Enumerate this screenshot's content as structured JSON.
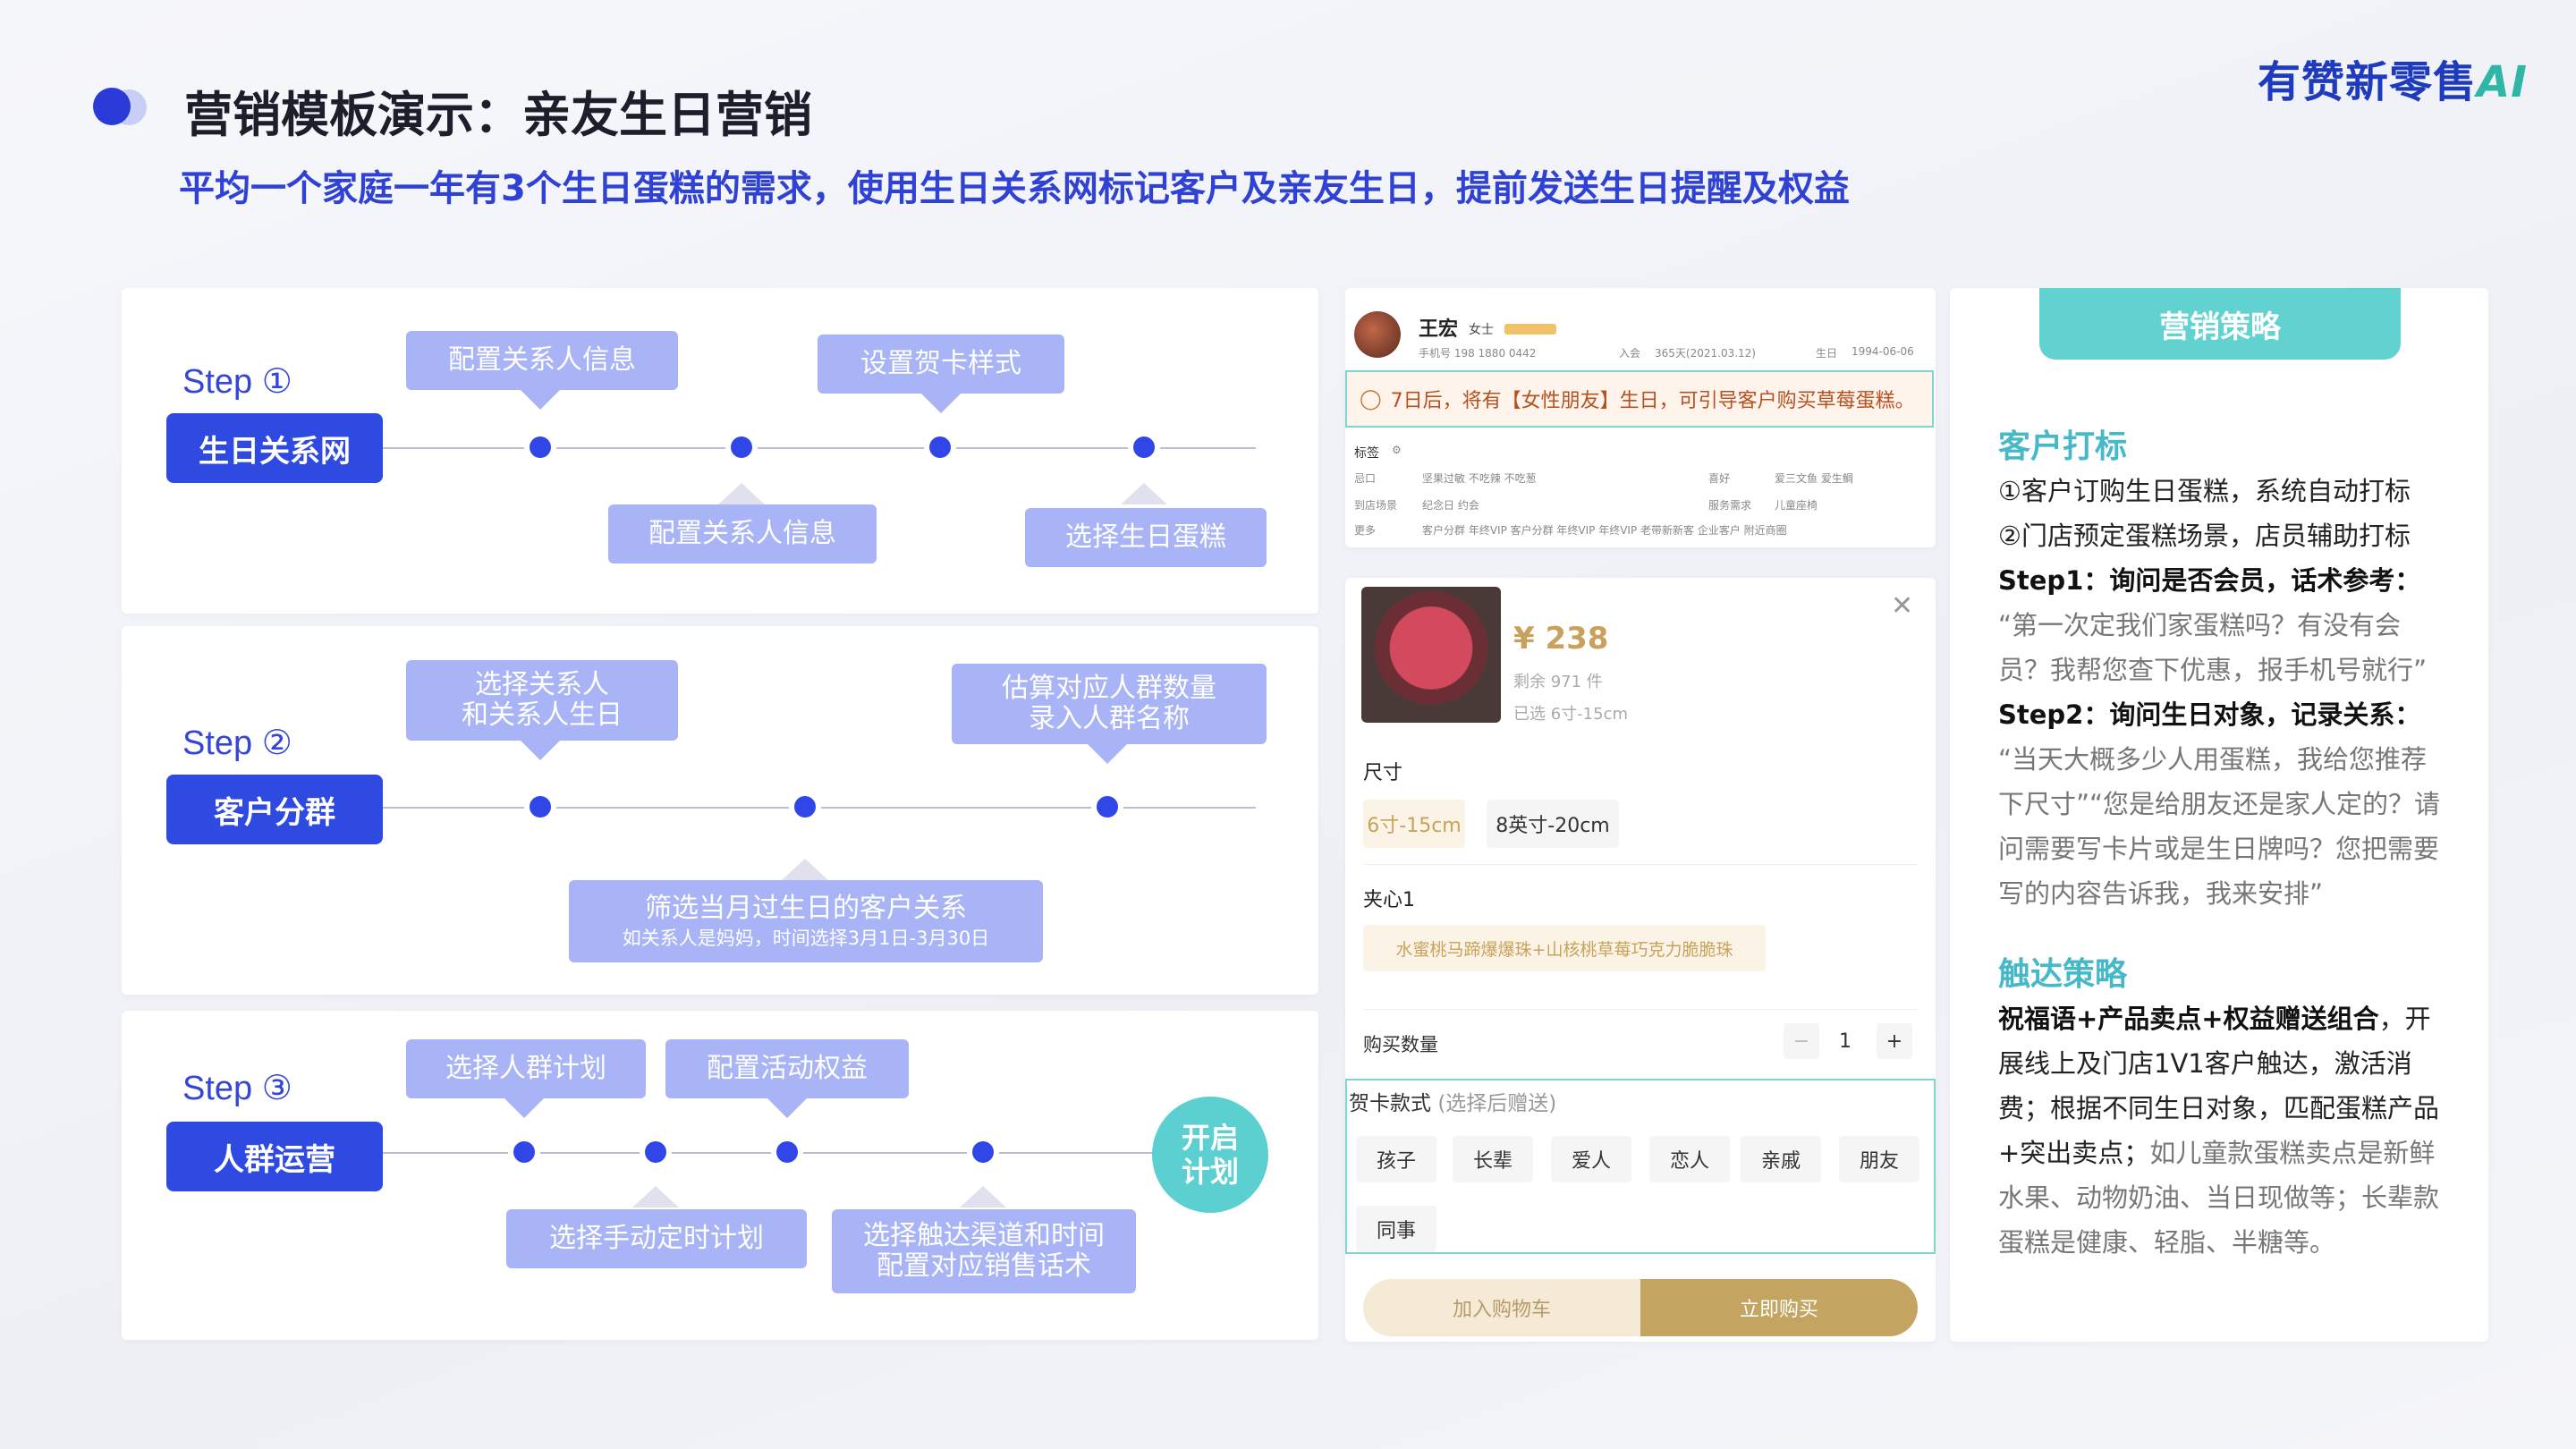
{
  "header": {
    "title": "营销模板演示：亲友生日营销",
    "subtitle": "平均一个家庭一年有3个生日蛋糕的需求，使用生日关系网标记客户及亲友生日，提前发送生日提醒及权益",
    "brand": "有赞新零售",
    "brand_ai": "AI"
  },
  "steps": [
    {
      "label": "Step ①",
      "button": "生日关系网",
      "tags_top": [
        "配置关系人信息",
        "设置贺卡样式"
      ],
      "tags_bottom": [
        "配置关系人信息",
        "选择生日蛋糕"
      ]
    },
    {
      "label": "Step ②",
      "button": "客户分群",
      "tags_top": [
        [
          "选择关系人",
          "和关系人生日"
        ],
        [
          "估算对应人群数量",
          "录入人群名称"
        ]
      ],
      "tags_bottom": [
        [
          "筛选当月过生日的客户关系",
          "如关系人是妈妈，时间选择3月1日-3月30日"
        ]
      ]
    },
    {
      "label": "Step ③",
      "button": "人群运营",
      "tags_top": [
        "选择人群计划",
        "配置活动权益"
      ],
      "tags_bottom": [
        "选择手动定时计划",
        [
          "选择触达渠道和时间",
          "配置对应销售话术"
        ]
      ],
      "start": [
        "开启",
        "计划"
      ]
    }
  ],
  "customer": {
    "name": "王宏",
    "gender": "女士",
    "phone": "手机号 198 1880 0442",
    "join": "入会",
    "join_days": "365天(2021.03.12)",
    "birthday_label": "生日",
    "birthday": "1994-06-06",
    "alert": "7日后，将有【女性朋友】生日，可引导客户购买草莓蛋糕。",
    "tags_title": "标签",
    "tag_rows": [
      [
        "忌口",
        "坚果过敏  不吃辣  不吃葱",
        "喜好",
        "爱三文鱼  爱生鲷"
      ],
      [
        "到店场景",
        "纪念日  约会",
        "服务需求",
        "儿童座椅"
      ],
      [
        "更多",
        "客户分群  年终VIP  客户分群  年终VIP  年终VIP  老带新新客  企业客户  附近商圈"
      ]
    ]
  },
  "product": {
    "price": "¥ 238",
    "stock": "剩余 971 件",
    "selected": "已选 6寸-15cm",
    "size_label": "尺寸",
    "sizes": [
      "6寸-15cm",
      "8英寸-20cm"
    ],
    "filling_label": "夹心1",
    "filling": "水蜜桃马蹄爆爆珠+山核桃草莓巧克力脆脆珠",
    "qty_label": "购买数量",
    "qty": "1",
    "card_label": "贺卡款式",
    "card_hint": "(选择后赠送)",
    "cards": [
      "孩子",
      "长辈",
      "爱人",
      "恋人",
      "亲戚",
      "朋友",
      "同事"
    ],
    "cart_btn": "加入购物车",
    "buy_btn": "立即购买"
  },
  "strategy": {
    "head": "营销策略",
    "sec1_title": "客户打标",
    "sec1_lines": [
      "①客户订购生日蛋糕，系统自动打标",
      "②门店预定蛋糕场景，店员辅助打标"
    ],
    "step1": "Step1：询问是否会员，话术参考：",
    "step1_quote": "“第一次定我们家蛋糕吗？有没有会员？我帮您查下优惠，报手机号就行”",
    "step2": "Step2：询问生日对象，记录关系：",
    "step2_quote": "“当天大概多少人用蛋糕，我给您推荐下尺寸”“您是给朋友还是家人定的？请问需要写卡片或是生日牌吗？您把需要写的内容告诉我，我来安排”",
    "sec2_title": "触达策略",
    "sec2_bold": "祝福语+产品卖点+权益赠送组合",
    "sec2_text1": "，开展线上及门店1V1客户触达，激活消费；",
    "sec2_text2": "根据不同生日对象，匹配蛋糕产品+突出卖点；",
    "sec2_gray": "如儿童款蛋糕卖点是新鲜水果、动物奶油、当日现做等；长辈款蛋糕是健康、轻脂、半糖等。"
  },
  "colors": {
    "primary": "#2f4ae0",
    "tag": "#a9b4f6",
    "teal": "#5ccfd1",
    "gold": "#c4a461"
  }
}
